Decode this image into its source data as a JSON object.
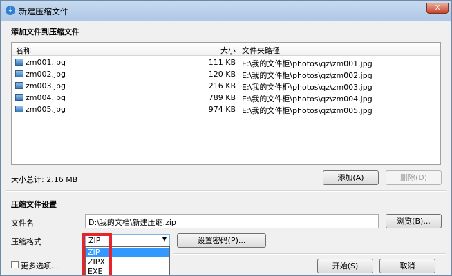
{
  "window": {
    "title": "新建压缩文件",
    "close_glyph": "X"
  },
  "section_add": {
    "title": "添加文件到压缩文件"
  },
  "list": {
    "columns": [
      "名称",
      "大小",
      "文件夹路径"
    ],
    "rows": [
      {
        "name": "zm001.jpg",
        "size": "111 KB",
        "path": "E:\\我的文件柜\\photos\\qz\\zm001.jpg"
      },
      {
        "name": "zm002.jpg",
        "size": "120 KB",
        "path": "E:\\我的文件柜\\photos\\qz\\zm002.jpg"
      },
      {
        "name": "zm003.jpg",
        "size": "216 KB",
        "path": "E:\\我的文件柜\\photos\\qz\\zm003.jpg"
      },
      {
        "name": "zm004.jpg",
        "size": "789 KB",
        "path": "E:\\我的文件柜\\photos\\qz\\zm004.jpg"
      },
      {
        "name": "zm005.jpg",
        "size": "974 KB",
        "path": "E:\\我的文件柜\\photos\\qz\\zm005.jpg"
      }
    ]
  },
  "summary": {
    "total": "大小总计: 2.16 MB"
  },
  "buttons": {
    "add": "添加(A)",
    "delete": "删除(D)",
    "browse": "浏览(B)...",
    "set_password": "设置密码(P)...",
    "start": "开始(S)",
    "cancel": "取消"
  },
  "settings": {
    "title": "压缩文件设置",
    "filename_label": "文件名",
    "filename_value": "D:\\我的文档\\新建压缩.zip",
    "format_label": "压缩格式",
    "format_selected": "ZIP",
    "format_options": [
      "ZIP",
      "ZIPX",
      "EXE"
    ],
    "more_options_label": "更多选项..."
  },
  "colors": {
    "highlight": "#3399ff",
    "annotation_red": "#e8242a"
  }
}
